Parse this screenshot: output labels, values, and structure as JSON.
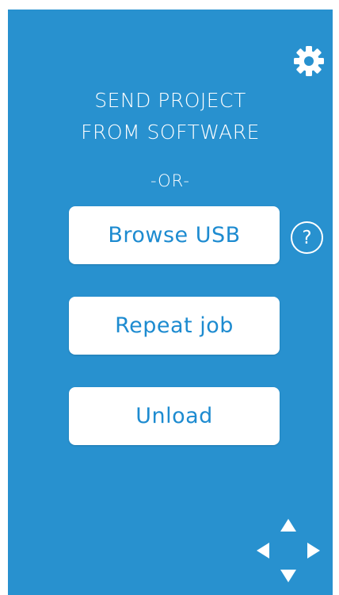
{
  "screen": {
    "background_color": "#2891cf",
    "settings_icon": "gear-icon",
    "title_line1": "SEND PROJECT",
    "title_line2": "FROM SOFTWARE",
    "or_label": "-OR-",
    "buttons": {
      "browse_usb": "Browse USB",
      "repeat_job": "Repeat job",
      "unload": "Unload"
    },
    "help_label": "?",
    "nav_icons": [
      "arrow-up-icon",
      "arrow-left-icon",
      "arrow-right-icon",
      "arrow-down-icon"
    ]
  }
}
